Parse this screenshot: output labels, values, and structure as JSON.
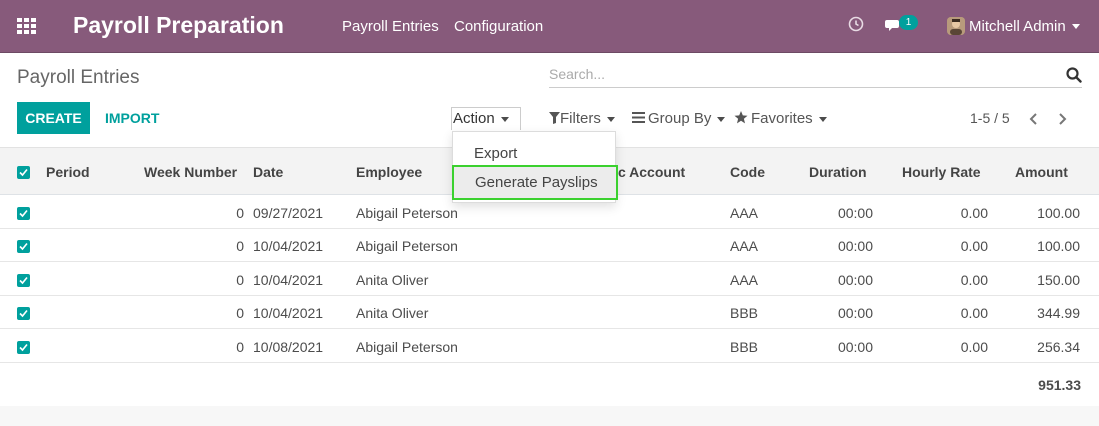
{
  "app": {
    "title": "Payroll Preparation"
  },
  "nav": {
    "menus": [
      "Payroll Entries",
      "Configuration"
    ],
    "messages_badge": "1",
    "user_name": "Mitchell Admin"
  },
  "control_panel": {
    "breadcrumb": "Payroll Entries",
    "search_placeholder": "Search...",
    "create_label": "CREATE",
    "import_label": "IMPORT",
    "action_label": "Action",
    "action_menu": [
      "Export",
      "Generate Payslips"
    ],
    "filters_label": "Filters",
    "groupby_label": "Group By",
    "favorites_label": "Favorites",
    "pager_text": "1-5 / 5"
  },
  "table": {
    "columns": [
      "Period",
      "Week Number",
      "Date",
      "Employee",
      "c Account",
      "Code",
      "Duration",
      "Hourly Rate",
      "Amount"
    ],
    "rows": [
      {
        "week": "0",
        "date": "09/27/2021",
        "employee": "Abigail Peterson",
        "code": "AAA",
        "duration": "00:00",
        "rate": "0.00",
        "amount": "100.00"
      },
      {
        "week": "0",
        "date": "10/04/2021",
        "employee": "Abigail Peterson",
        "code": "AAA",
        "duration": "00:00",
        "rate": "0.00",
        "amount": "100.00"
      },
      {
        "week": "0",
        "date": "10/04/2021",
        "employee": "Anita Oliver",
        "code": "AAA",
        "duration": "00:00",
        "rate": "0.00",
        "amount": "150.00"
      },
      {
        "week": "0",
        "date": "10/04/2021",
        "employee": "Anita Oliver",
        "code": "BBB",
        "duration": "00:00",
        "rate": "0.00",
        "amount": "344.99"
      },
      {
        "week": "0",
        "date": "10/08/2021",
        "employee": "Abigail Peterson",
        "code": "BBB",
        "duration": "00:00",
        "rate": "0.00",
        "amount": "256.34"
      }
    ],
    "total_amount": "951.33"
  },
  "colors": {
    "navbar": "#875a7b",
    "primary": "#00a09d",
    "highlight": "#3bd12f"
  }
}
